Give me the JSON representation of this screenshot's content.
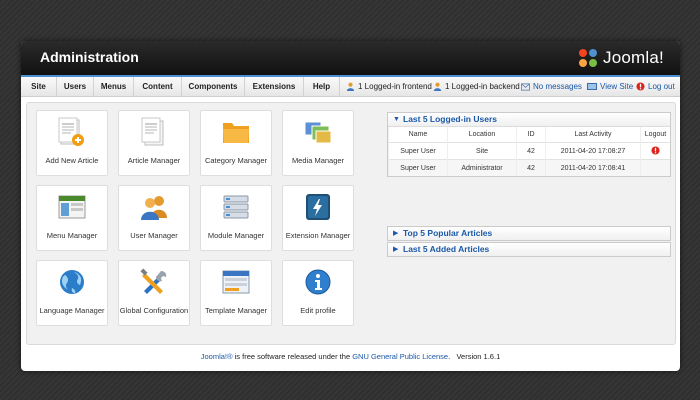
{
  "header": {
    "title": "Administration",
    "logo_text": "Joomla!"
  },
  "menu": [
    {
      "label": "Site"
    },
    {
      "label": "Users"
    },
    {
      "label": "Menus"
    },
    {
      "label": "Content"
    },
    {
      "label": "Components"
    },
    {
      "label": "Extensions"
    },
    {
      "label": "Help"
    }
  ],
  "status": {
    "frontend": "1 Logged-in frontend",
    "backend": "1 Logged-in backend",
    "messages": "No messages",
    "view_site": "View Site",
    "logout": "Log out"
  },
  "tiles": [
    {
      "label": "Add New Article",
      "icon": "add-article-icon"
    },
    {
      "label": "Article Manager",
      "icon": "article-icon"
    },
    {
      "label": "Category Manager",
      "icon": "folder-icon"
    },
    {
      "label": "Media Manager",
      "icon": "media-icon"
    },
    {
      "label": "Menu Manager",
      "icon": "menu-icon"
    },
    {
      "label": "User Manager",
      "icon": "users-icon"
    },
    {
      "label": "Module Manager",
      "icon": "module-icon"
    },
    {
      "label": "Extension Manager",
      "icon": "extension-icon"
    },
    {
      "label": "Language Manager",
      "icon": "globe-icon"
    },
    {
      "label": "Global Configuration",
      "icon": "tools-icon"
    },
    {
      "label": "Template Manager",
      "icon": "template-icon"
    },
    {
      "label": "Edit profile",
      "icon": "info-icon"
    }
  ],
  "logged_in": {
    "title": "Last 5 Logged-in Users",
    "columns": [
      "Name",
      "Location",
      "ID",
      "Last Activity",
      "Logout"
    ],
    "rows": [
      {
        "name": "Super User",
        "location": "Site",
        "id": "42",
        "activity": "2011-04-20 17:08:27"
      },
      {
        "name": "Super User",
        "location": "Administrator",
        "id": "42",
        "activity": "2011-04-20 17:08:41"
      }
    ]
  },
  "popular": {
    "title": "Top 5 Popular Articles"
  },
  "added": {
    "title": "Last 5 Added Articles"
  },
  "footer": {
    "brand": "Joomla!®",
    "text1": " is free software released under the ",
    "license": "GNU General Public License",
    "text2": ".",
    "version": "Version 1.6.1"
  },
  "colors": {
    "accent": "#1a58a8",
    "header_bg": "#1c1c1c",
    "strip": "#4a8fd0",
    "logout_red": "#d9261c"
  }
}
